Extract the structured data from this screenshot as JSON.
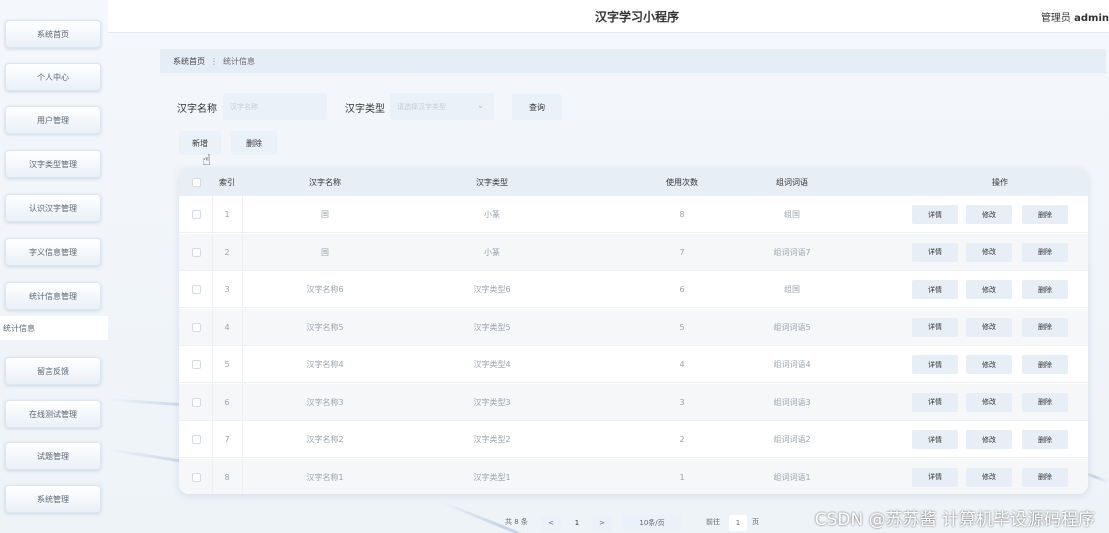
{
  "header": {
    "title": "汉字学习小程序",
    "admin_label": "管理员",
    "admin_name": "admin"
  },
  "sidebar": {
    "items": [
      {
        "label": "系统首页"
      },
      {
        "label": "个人中心"
      },
      {
        "label": "用户管理"
      },
      {
        "label": "汉字类型管理"
      },
      {
        "label": "认识汉字管理"
      },
      {
        "label": "字义信息管理"
      },
      {
        "label": "统计信息管理"
      },
      {
        "label": "留言反馈"
      },
      {
        "label": "在线测试管理"
      },
      {
        "label": "试题管理"
      },
      {
        "label": "系统管理"
      }
    ],
    "sub_item": "统计信息"
  },
  "breadcrumb": {
    "home": "系统首页",
    "separator": "⋮",
    "current": "统计信息"
  },
  "search": {
    "name_label": "汉字名称",
    "name_placeholder": "汉字名称",
    "type_label": "汉字类型",
    "type_placeholder": "请选择汉字类型",
    "query_button": "查询"
  },
  "actions": {
    "add": "新增",
    "delete": "删除"
  },
  "table": {
    "columns": [
      "索引",
      "汉字名称",
      "汉字类型",
      "使用次数",
      "组词词语",
      "操作"
    ],
    "rows": [
      {
        "index": "1",
        "name": "国",
        "type": "小篆",
        "count": "8",
        "words": "组国"
      },
      {
        "index": "2",
        "name": "国",
        "type": "小篆",
        "count": "7",
        "words": "组词词语7"
      },
      {
        "index": "3",
        "name": "汉字名称6",
        "type": "汉字类型6",
        "count": "6",
        "words": "组国"
      },
      {
        "index": "4",
        "name": "汉字名称5",
        "type": "汉字类型5",
        "count": "5",
        "words": "组词词语5"
      },
      {
        "index": "5",
        "name": "汉字名称4",
        "type": "汉字类型4",
        "count": "4",
        "words": "组词词语4"
      },
      {
        "index": "6",
        "name": "汉字名称3",
        "type": "汉字类型3",
        "count": "3",
        "words": "组词词语3"
      },
      {
        "index": "7",
        "name": "汉字名称2",
        "type": "汉字类型2",
        "count": "2",
        "words": "组词词语2"
      },
      {
        "index": "8",
        "name": "汉字名称1",
        "type": "汉字类型1",
        "count": "1",
        "words": "组词词语1"
      }
    ],
    "row_actions": {
      "detail": "详情",
      "edit": "修改",
      "delete": "删除"
    }
  },
  "pagination": {
    "total": "共 8 条",
    "prev": "<",
    "page": "1",
    "next": ">",
    "page_size": "10条/页",
    "goto_label": "前往",
    "goto_value": "1",
    "page_suffix": "页"
  },
  "watermark": "CSDN @苏苏酱    计算机毕设源码程序"
}
